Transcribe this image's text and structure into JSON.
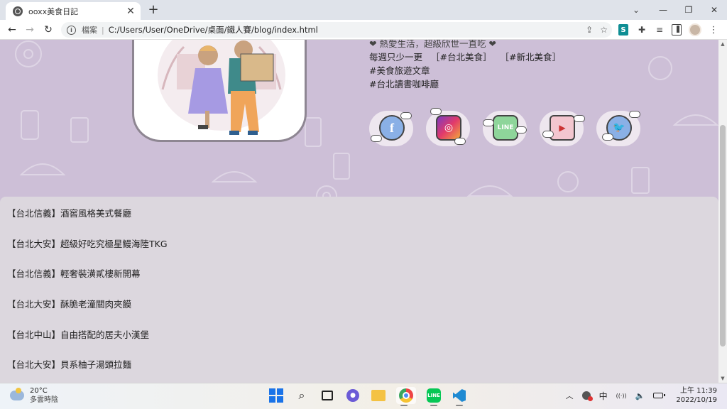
{
  "browser": {
    "tab": {
      "title": "ooxx美食日記",
      "close_glyph": "✕"
    },
    "new_tab_glyph": "+",
    "tab_search_glyph": "⌄",
    "window_controls": {
      "minimize": "—",
      "maximize": "❐",
      "close": "✕"
    },
    "nav": {
      "back": "←",
      "forward": "→",
      "reload": "↻"
    },
    "omnibox": {
      "security_label": "檔案",
      "separator": "|",
      "url": "C:/Users/User/OneDrive/桌面/鐵人賽/blog/index.html",
      "share_icon": "⇪",
      "bookmark_icon": "☆"
    },
    "extensions": {
      "s_label": "S",
      "puzzle_icon": "✚",
      "list_icon": "≡",
      "menu_icon": "⋮"
    }
  },
  "page": {
    "background_color": "#cdbfd7",
    "profile": {
      "line1_clipped": "❤ 熱愛生活，超級欣世一直吃 ❤",
      "line2_prefix": "每週只少一更",
      "tags_line2": [
        "［#台北美食］",
        "［#新北美食］"
      ],
      "line3": "#美食旅遊文章",
      "line4": "#台北讀書咖啡廳"
    },
    "socials": [
      {
        "name": "facebook",
        "glyph": "f"
      },
      {
        "name": "instagram",
        "glyph": "◎"
      },
      {
        "name": "line",
        "glyph": "LINE"
      },
      {
        "name": "youtube",
        "glyph": "▶"
      },
      {
        "name": "twitter",
        "glyph": "🐦"
      }
    ],
    "articles": [
      "【台北信義】酒窖風格美式餐廳",
      "【台北大安】超級好吃究極星鰻海陸TKG",
      "【台北信義】輕奢裝潢貳樓新開幕",
      "【台北大安】酥脆老潼關肉夾饃",
      "【台北中山】自由搭配的居夫小漢堡",
      "【台北大安】貝系柚子湯頭拉麵"
    ]
  },
  "scrollbar": {
    "up": "▲",
    "down": "▼"
  },
  "taskbar": {
    "weather": {
      "temp": "20°C",
      "desc": "多雲時陰"
    },
    "chat_label": "●",
    "line_label": "LINE",
    "tray": {
      "chevron": "︿",
      "ime": "中",
      "wifi": "((·))",
      "volume": "🔈"
    },
    "clock": {
      "time": "上午 11:39",
      "date": "2022/10/19"
    }
  }
}
